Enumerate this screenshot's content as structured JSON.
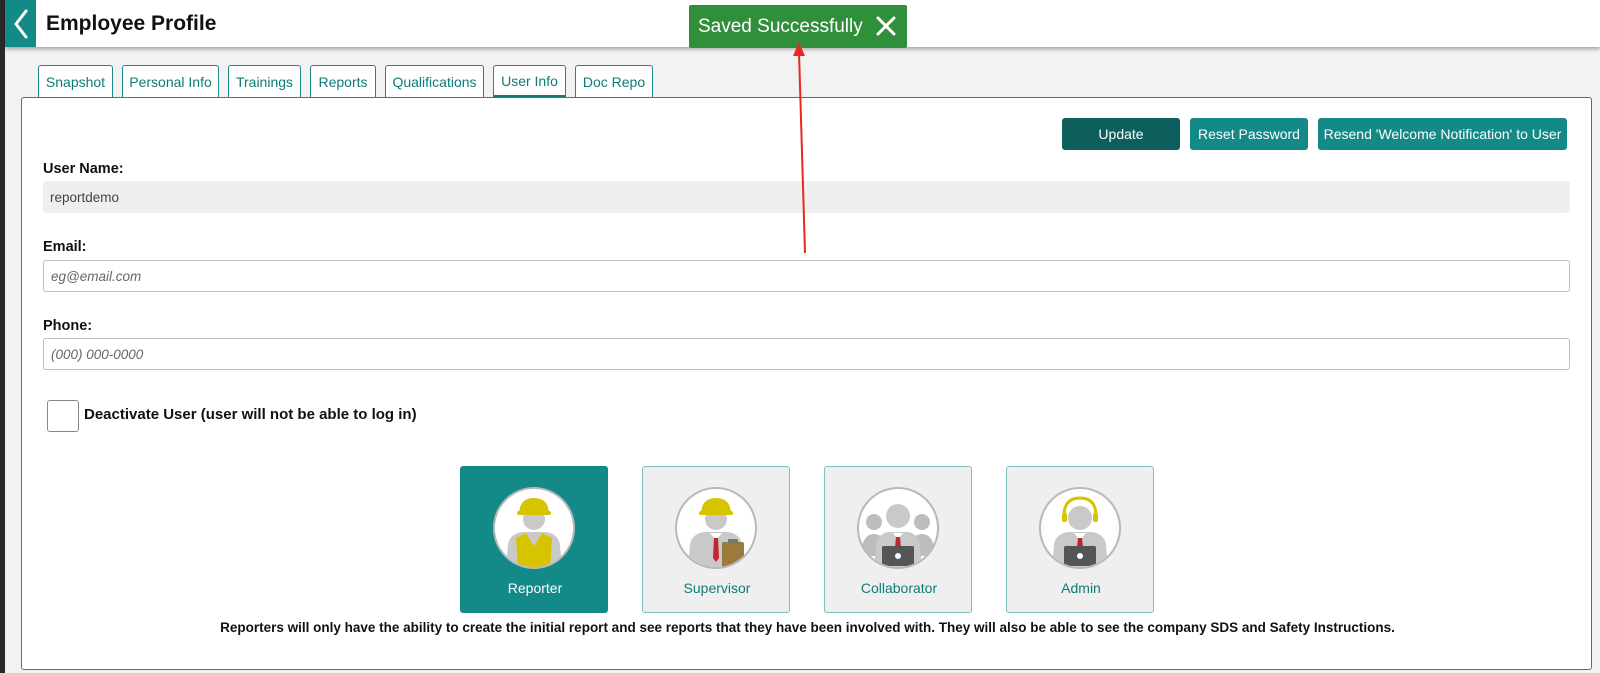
{
  "header": {
    "title": "Employee Profile",
    "back_icon": "chevron-left-icon"
  },
  "toast": {
    "message": "Saved Successfully",
    "close_icon": "close-icon"
  },
  "tabs": [
    {
      "label": "Snapshot",
      "active": false
    },
    {
      "label": "Personal Info",
      "active": false
    },
    {
      "label": "Trainings",
      "active": false
    },
    {
      "label": "Reports",
      "active": false
    },
    {
      "label": "Qualifications",
      "active": false
    },
    {
      "label": "User Info",
      "active": true
    },
    {
      "label": "Doc Repo",
      "active": false
    }
  ],
  "actions": {
    "update": "Update",
    "reset_password": "Reset Password",
    "resend_welcome": "Resend 'Welcome Notification' to User"
  },
  "form": {
    "username_label": "User Name:",
    "username_value": "reportdemo",
    "email_label": "Email:",
    "email_placeholder": "eg@email.com",
    "phone_label": "Phone:",
    "phone_placeholder": "(000) 000-0000",
    "deactivate_label": "Deactivate User (user will not be able to log in)",
    "deactivate_checked": false
  },
  "roles": {
    "selected": "Reporter",
    "items": [
      {
        "label": "Reporter",
        "icon": "reporter-avatar-icon"
      },
      {
        "label": "Supervisor",
        "icon": "supervisor-avatar-icon"
      },
      {
        "label": "Collaborator",
        "icon": "collaborator-avatar-icon"
      },
      {
        "label": "Admin",
        "icon": "admin-avatar-icon"
      }
    ],
    "description": "Reporters will only have the ability to create the initial report and see reports that they have been involved with. They will also be able to see the company SDS and Safety Instructions."
  },
  "colors": {
    "accent": "#138a87",
    "accent_dark": "#0c5f5d",
    "toast_green": "#2f8f3b",
    "annotation_arrow": "#e8281e",
    "helmet_yellow": "#d6c400"
  }
}
